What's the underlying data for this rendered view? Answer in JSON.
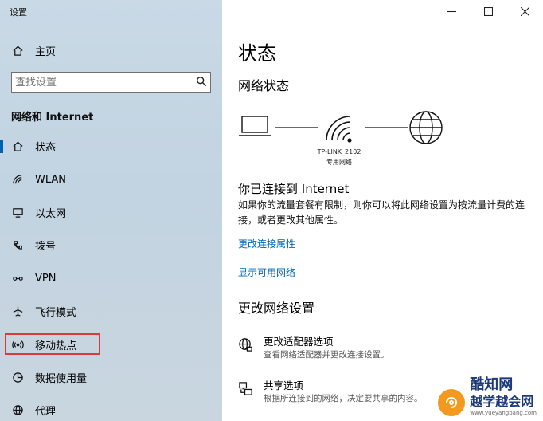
{
  "window": {
    "title": "设置"
  },
  "sidebar": {
    "home_label": "主页",
    "search_placeholder": "查找设置",
    "section_title": "网络和 Internet",
    "items": [
      {
        "label": "状态",
        "icon": "home-status-icon"
      },
      {
        "label": "WLAN",
        "icon": "wifi-icon"
      },
      {
        "label": "以太网",
        "icon": "ethernet-icon"
      },
      {
        "label": "拨号",
        "icon": "dialup-icon"
      },
      {
        "label": "VPN",
        "icon": "vpn-icon"
      },
      {
        "label": "飞行模式",
        "icon": "airplane-icon"
      },
      {
        "label": "移动热点",
        "icon": "hotspot-icon"
      },
      {
        "label": "数据使用量",
        "icon": "data-usage-icon"
      },
      {
        "label": "代理",
        "icon": "globe-icon"
      }
    ],
    "active_index": 0,
    "highlighted_index": 6,
    "accent_color": "#0063b1",
    "highlight_color": "#d93a3a"
  },
  "main": {
    "page_title": "状态",
    "network_status_title": "网络状态",
    "network": {
      "ssid": "TP-LINK_2102",
      "type": "专用网络"
    },
    "connected_title": "你已连接到 Internet",
    "connected_desc": "如果你的流量套餐有限制，则你可以将此网络设置为按流量计费的连接，或者更改其他属性。",
    "link_change_properties": "更改连接属性",
    "link_show_networks": "显示可用网络",
    "change_settings_title": "更改网络设置",
    "options": [
      {
        "title": "更改适配器选项",
        "desc": "查看网络适配器并更改连接设置。",
        "icon": "adapter-globe-icon"
      },
      {
        "title": "共享选项",
        "desc": "根据所连接到的网络，决定要共享的内容。",
        "icon": "sharing-icon"
      }
    ],
    "link_color": "#0067b8"
  },
  "watermark": {
    "main": "酷知网",
    "secondary": "越学越会网",
    "url": "www.yueyangbang.com"
  }
}
